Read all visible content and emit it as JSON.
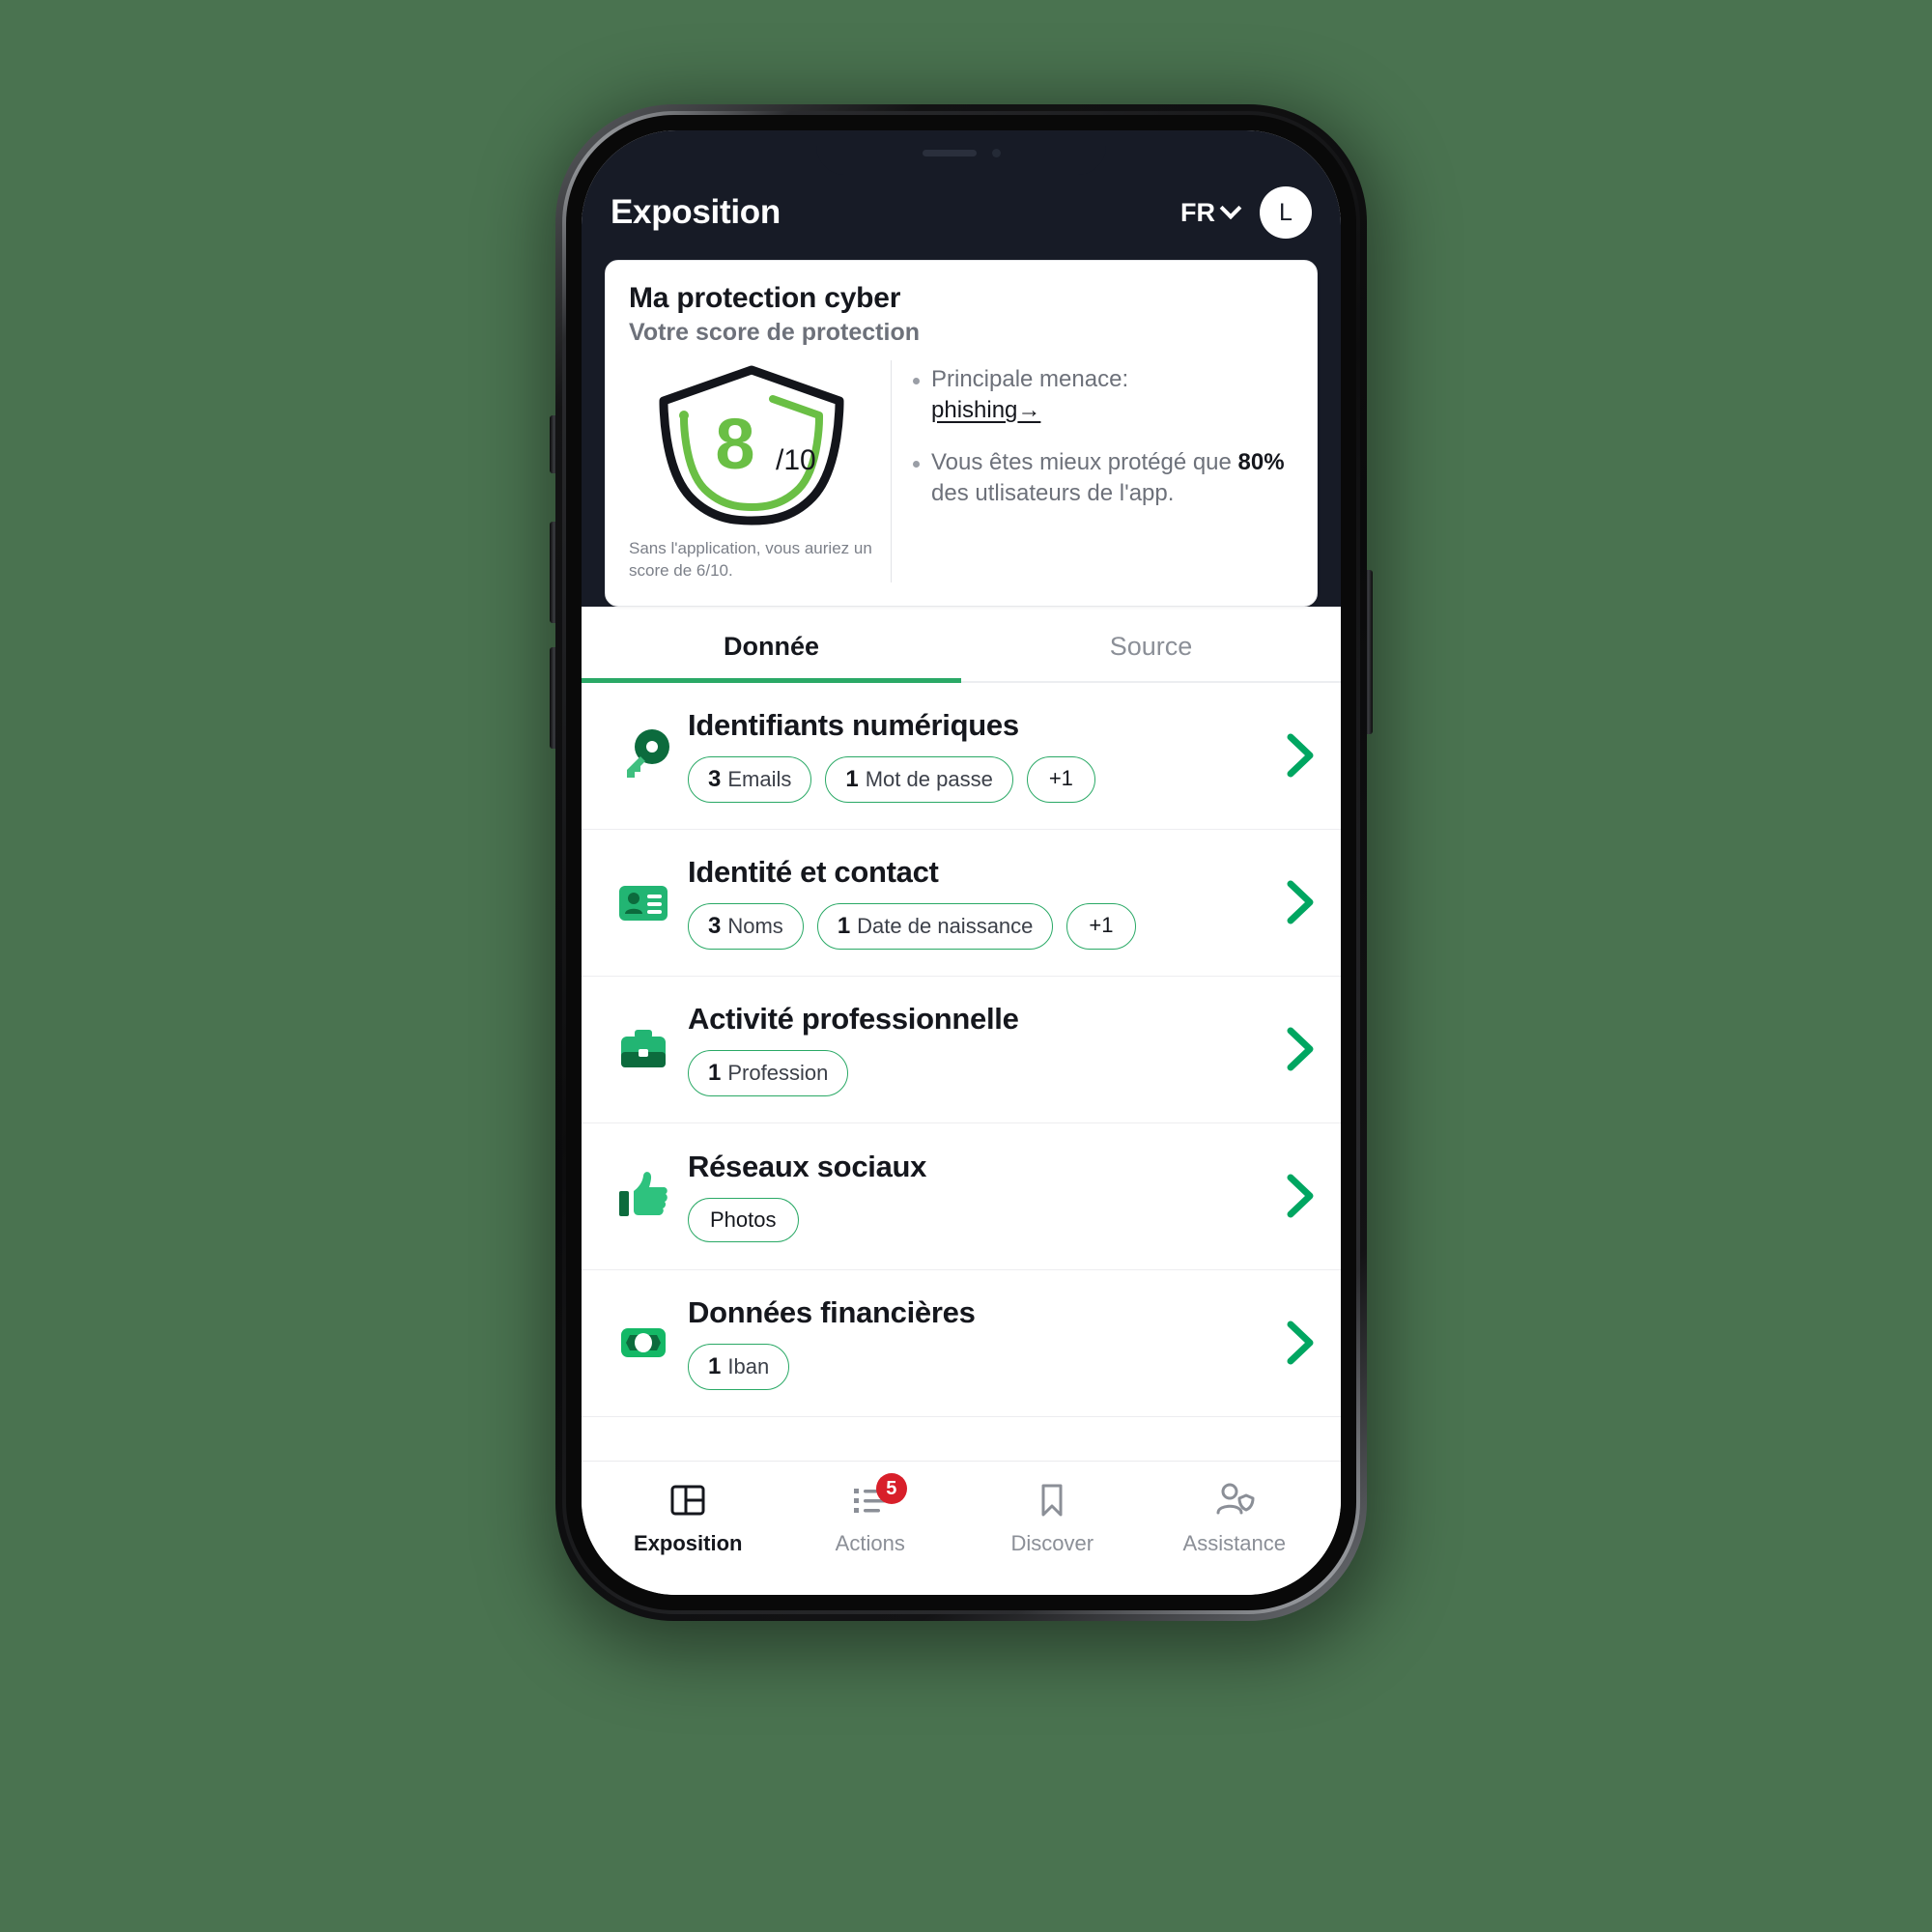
{
  "background_color": "#4a7350",
  "theme": {
    "header_bg": "#171b26",
    "accent_green": "#2aa966",
    "score_green": "#6abf45",
    "badge_red": "#d81f2a"
  },
  "header": {
    "title": "Exposition",
    "language": "FR",
    "chevron_icon": "chevron-down-icon",
    "avatar_initial": "L"
  },
  "score_card": {
    "title": "Ma protection cyber",
    "subtitle": "Votre score de protection",
    "score_value": "8",
    "score_denominator": "/10",
    "score_percent": 80,
    "footnote": "Sans l'application, vous auriez un score de 6/10.",
    "bullets": [
      {
        "prefix": "Principale menace:",
        "link_text": "phishing",
        "link_arrow": "→"
      },
      {
        "text_before": "Vous êtes mieux protégé que ",
        "highlight": "80%",
        "text_after": " des utlisateurs de l'app."
      }
    ]
  },
  "tabs": [
    {
      "label": "Donnée",
      "active": true
    },
    {
      "label": "Source",
      "active": false
    }
  ],
  "list": [
    {
      "icon": "key-icon",
      "title": "Identifiants numériques",
      "chips": [
        {
          "count": "3",
          "label": "Emails"
        },
        {
          "count": "1",
          "label": "Mot de passe"
        },
        {
          "count": "",
          "label": "+1"
        }
      ]
    },
    {
      "icon": "id-card-icon",
      "title": "Identité et contact",
      "chips": [
        {
          "count": "3",
          "label": "Noms"
        },
        {
          "count": "1",
          "label": "Date de naissance"
        },
        {
          "count": "",
          "label": "+1"
        }
      ]
    },
    {
      "icon": "briefcase-icon",
      "title": "Activité professionnelle",
      "chips": [
        {
          "count": "1",
          "label": "Profession"
        }
      ]
    },
    {
      "icon": "thumbs-up-icon",
      "title": "Réseaux sociaux",
      "chips": [
        {
          "count": "",
          "label": "Photos"
        }
      ]
    },
    {
      "icon": "banknote-icon",
      "title": "Données financières",
      "chips": [
        {
          "count": "1",
          "label": "Iban"
        }
      ]
    }
  ],
  "bottom_nav": [
    {
      "label": "Exposition",
      "icon": "dashboard-icon",
      "active": true,
      "badge": ""
    },
    {
      "label": "Actions",
      "icon": "checklist-icon",
      "active": false,
      "badge": "5"
    },
    {
      "label": "Discover",
      "icon": "bookmark-icon",
      "active": false,
      "badge": ""
    },
    {
      "label": "Assistance",
      "icon": "user-shield-icon",
      "active": false,
      "badge": ""
    }
  ]
}
